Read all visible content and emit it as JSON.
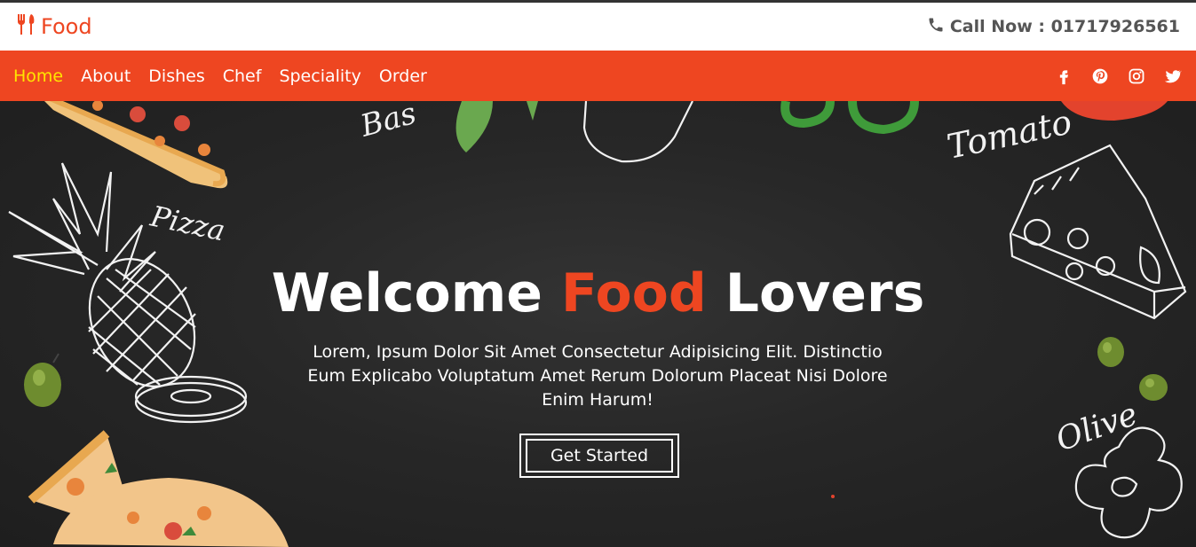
{
  "header": {
    "brand": "Food",
    "call_now": "Call Now : 01717926561"
  },
  "nav": {
    "items": [
      {
        "label": "Home",
        "active": true
      },
      {
        "label": "About"
      },
      {
        "label": "Dishes"
      },
      {
        "label": "Chef"
      },
      {
        "label": "Speciality"
      },
      {
        "label": "Order"
      }
    ],
    "socials": [
      "facebook-icon",
      "pinterest-icon",
      "instagram-icon",
      "twitter-icon"
    ]
  },
  "hero": {
    "title_part1": "Welcome",
    "title_accent": "Food",
    "title_part2": "Lovers",
    "description": "Lorem, Ipsum Dolor Sit Amet Consectetur Adipisicing Elit. Distinctio Eum Explicabo Voluptatum Amet Rerum Dolorum Placeat Nisi Dolore Enim Harum!",
    "button_label": "Get Started",
    "doodle_words": [
      "Pizza",
      "Tomato",
      "Olive",
      "Bas"
    ]
  },
  "colors": {
    "accent": "#ee4621",
    "active_nav": "#ffe400",
    "hero_bg": "#272727"
  }
}
